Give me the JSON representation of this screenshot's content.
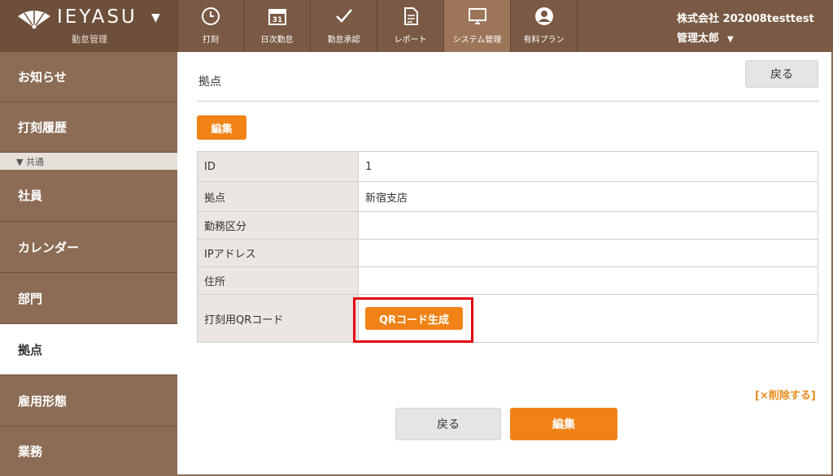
{
  "app": {
    "brand": "IEYASU",
    "subtitle": "勤怠管理",
    "company": "株式会社 202008testtest",
    "user": "管理太郎",
    "colors": {
      "header": "#7a5a44",
      "sidebar": "#8c6c55",
      "accent": "#f08216",
      "highlight": "#e60012"
    }
  },
  "nav": [
    {
      "label": "打刻",
      "icon": "clock-icon"
    },
    {
      "label": "日次勤怠",
      "icon": "calendar-icon"
    },
    {
      "label": "勤怠承認",
      "icon": "check-icon"
    },
    {
      "label": "レポート",
      "icon": "document-icon"
    },
    {
      "label": "システム管理",
      "icon": "monitor-icon"
    },
    {
      "label": "有料プラン",
      "icon": "user-icon"
    }
  ],
  "sidebar": {
    "items": [
      {
        "label": "お知らせ"
      },
      {
        "label": "打刻履歴"
      },
      {
        "label": "社員"
      },
      {
        "label": "カレンダー"
      },
      {
        "label": "部門"
      },
      {
        "label": "拠点"
      },
      {
        "label": "雇用形態"
      },
      {
        "label": "業務"
      }
    ],
    "section_header": "▼ 共通"
  },
  "main": {
    "title": "拠点",
    "back_label": "戻る",
    "edit_label": "編集",
    "rows": [
      {
        "key": "ID",
        "value": "1"
      },
      {
        "key": "拠点",
        "value": "新宿支店"
      },
      {
        "key": "勤務区分",
        "value": ""
      },
      {
        "key": "IPアドレス",
        "value": ""
      },
      {
        "key": "住所",
        "value": ""
      },
      {
        "key": "打刻用QRコード",
        "value": ""
      }
    ],
    "qr_button": "QRコード生成",
    "delete_link": "[×削除する]"
  }
}
